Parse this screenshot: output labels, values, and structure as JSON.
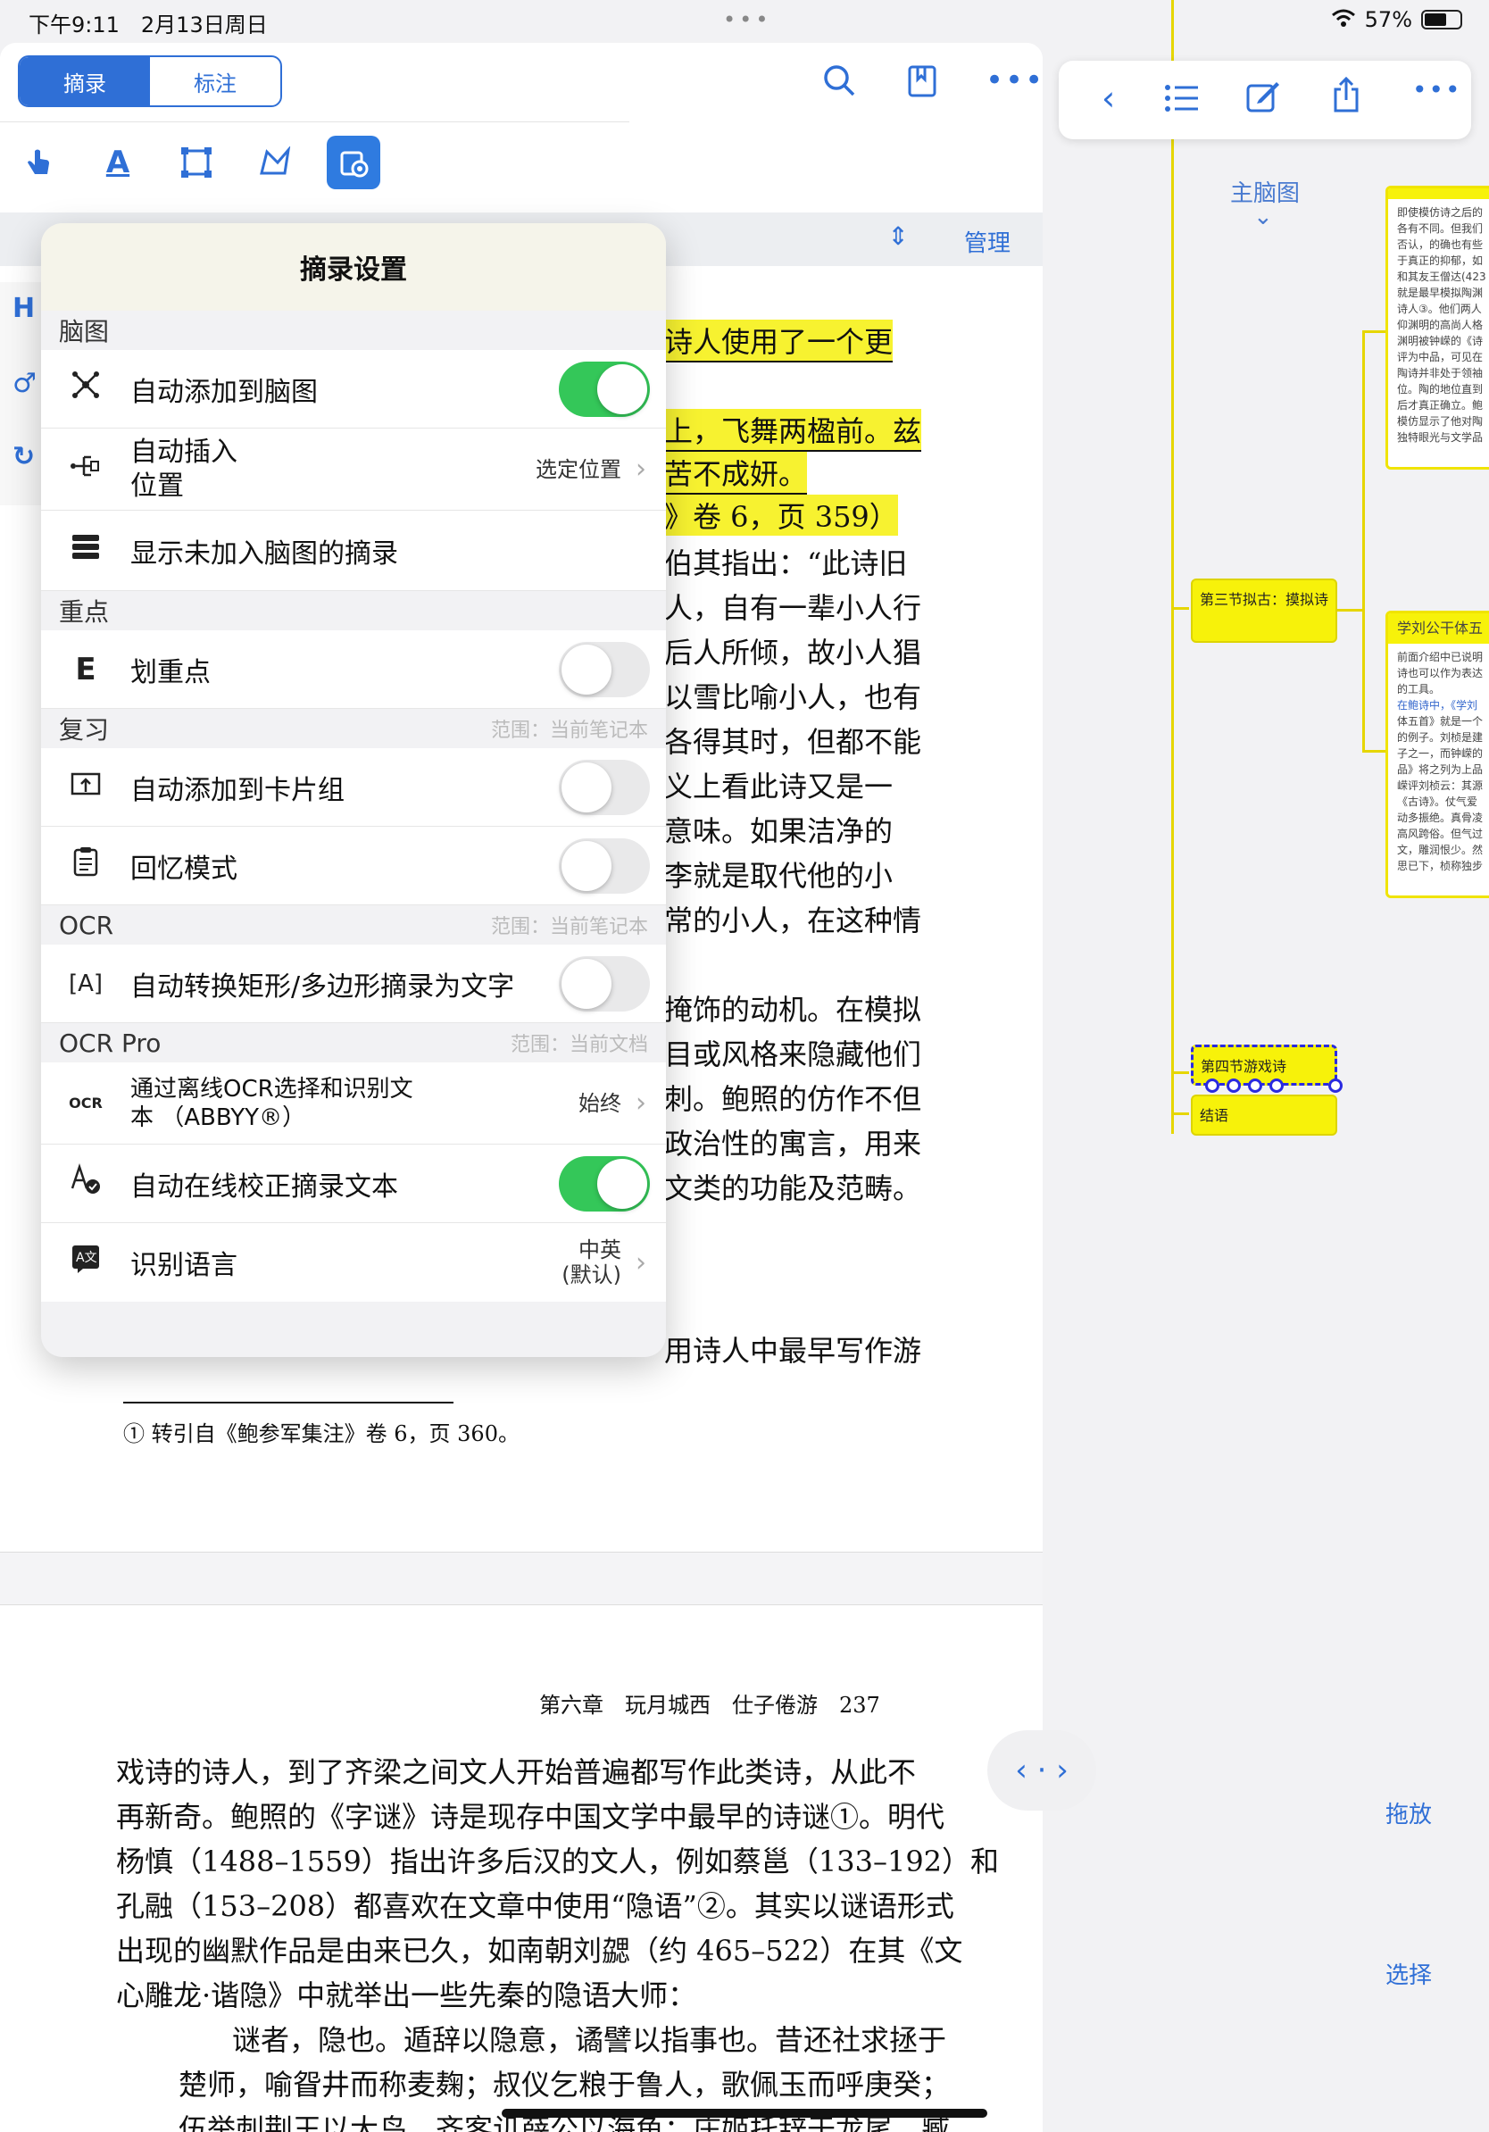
{
  "status": {
    "time": "下午9:11",
    "date": "2月13日周日",
    "battery": "57%"
  },
  "toolbar": {
    "seg_excerpt": "摘录",
    "seg_annotate": "标注",
    "manage": "管理"
  },
  "book": {
    "lines_top": [
      "诗人使用了一个更",
      "上，飞舞两楹前。兹",
      "苦不成妍。",
      "》卷 6，页 359）",
      "伯其指出：“此诗旧",
      "人，自有一辈小人行",
      "后人所倾，故小人猖",
      "以雪比喻小人，也有",
      "各得其时，但都不能",
      "义上看此诗又是一",
      "意味。如果洁净的",
      "李就是取代他的小",
      "常的小人，在这种情",
      "掩饰的动机。在模拟",
      "目或风格来隐藏他们",
      "刺。鲍照的仿作不但",
      "政治性的寓言，用来",
      "文类的功能及范畴。",
      "用诗人中最早写作游"
    ],
    "footnote": "① 转引自《鲍参军集注》卷 6，页 360。",
    "page_header": "第六章　玩月城西　仕子倦游　237",
    "lines_bottom": [
      "戏诗的诗人，到了齐梁之间文人开始普遍都写作此类诗，从此不",
      "再新奇。鲍照的《字谜》诗是现存中国文学中最早的诗谜①。明代",
      "杨慎（1488–1559）指出许多后汉的文人，例如蔡邕（133–192）和",
      "孔融（153–208）都喜欢在文章中使用“隐语”②。其实以谜语形式",
      "出现的幽默作品是由来已久，如南朝刘勰（约 465–522）在其《文",
      "心雕龙·谐隐》中就举出一些先秦的隐语大师：",
      "谜者，隐也。遁辞以隐意，谲譬以指事也。昔还社求拯于",
      "楚师，喻眢井而称麦麹；叔仪乞粮于鲁人，歌佩玉而呼庚癸；",
      "伍举刺荆王以大鸟，齐客讥薛公以海鱼；庄姬托辞于龙尾，臧"
    ]
  },
  "popover": {
    "title": "摘录设置",
    "sections": [
      {
        "header": "脑图",
        "scope": ""
      },
      {
        "header": "重点",
        "scope": ""
      },
      {
        "header": "复习",
        "scope": "范围：当前笔记本"
      },
      {
        "header": "OCR",
        "scope": "范围：当前笔记本"
      },
      {
        "header": "OCR Pro",
        "scope": "范围：当前文档"
      }
    ],
    "rows": {
      "auto_add_map": "自动添加到脑图",
      "auto_insert_l1": "自动插入",
      "auto_insert_l2": "位置",
      "auto_insert_val": "选定位置",
      "show_unadded": "显示未加入脑图的摘录",
      "highlight": "划重点",
      "auto_add_cards": "自动添加到卡片组",
      "recall_mode": "回忆模式",
      "auto_convert": "自动转换矩形/多边形摘录为文字",
      "offline_ocr_l1": "通过离线OCR选择和识别文",
      "offline_ocr_l2": "本 （ABBYY®）",
      "offline_ocr_val": "始终",
      "auto_correct": "自动在线校正摘录文本",
      "recog_lang": "识别语言",
      "recog_lang_val1": "中英",
      "recog_lang_val2": "(默认)"
    },
    "toggles": {
      "auto_add_map": true,
      "highlight": false,
      "auto_add_cards": false,
      "recall_mode": false,
      "auto_convert": false,
      "auto_correct": true
    }
  },
  "mindmap": {
    "title": "主脑图",
    "node_section3": "第三节拟古：摸拟诗",
    "node_section4": "第四节游戏诗",
    "node_conclusion": "结语",
    "card1_text": [
      "即使模仿诗之后的",
      "各有不同。但我们",
      "否认，的确也有些",
      "于真正的抑郁，如",
      "和其友王僧达(423",
      "就是最早模拟陶渊",
      "诗人③。他们两人",
      "仰渊明的高尚人格",
      "渊明被钟嵘的《诗",
      "评为中品，可见在",
      "陶诗并非处于领袖",
      "位。陶的地位直到",
      "后才真正确立。鲍",
      "模仿显示了他对陶",
      "独特眼光与文学品"
    ],
    "card2_title": "学刘公干体五",
    "card2_text": [
      "前面介绍中已说明",
      "诗也可以作为表达",
      "的工具。",
      "在鲍诗中，《学刘",
      "体五首》就是一个",
      "的例子。刘桢是建",
      "子之一，而钟嵘的",
      "品》将之列为上品",
      "嵘评刘桢云：其源",
      "《古诗》。仗气爱",
      "动多振绝。真骨凌",
      "高风跨俗。但气过",
      "文，雕润恨少。然",
      "思已下，桢称独步"
    ]
  },
  "buttons": {
    "drag": "拖放",
    "select": "选择"
  },
  "icons": [
    "hand-pointer-icon",
    "text-highlight-icon",
    "rect-select-icon",
    "lasso-icon",
    "excerpt-settings-icon",
    "search-icon",
    "bookmark-icon",
    "more-icon",
    "back-icon",
    "list-icon",
    "edit-icon",
    "share-icon"
  ]
}
